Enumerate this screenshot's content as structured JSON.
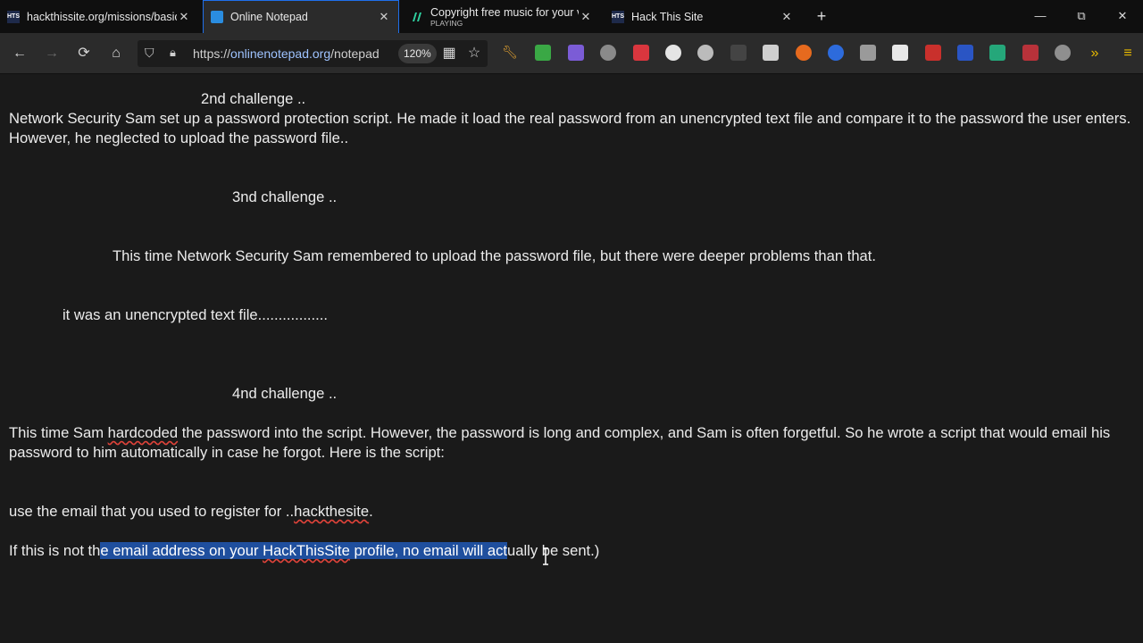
{
  "browser": {
    "tabs": [
      {
        "title": "hackthissite.org/missions/basic",
        "favicon": "HTS",
        "active": false
      },
      {
        "title": "Online Notepad",
        "favicon": "notepad-icon",
        "active": true
      },
      {
        "title": "Copyright free music for your vi",
        "subtitle": "PLAYING",
        "favicon": "music-icon",
        "active": false
      },
      {
        "title": "Hack This Site",
        "favicon": "HTS",
        "active": false
      }
    ],
    "close_glyph": "✕",
    "new_tab_glyph": "+",
    "window_controls": {
      "minimize": "—",
      "restore": "⧉",
      "close": "✕"
    }
  },
  "toolbar": {
    "url_prefix": "https://",
    "url_host": "onlinenotepad.org",
    "url_path": "/notepad",
    "zoom": "120%",
    "icons": [
      "back-icon",
      "forward-icon",
      "reload-icon",
      "home-icon",
      "shield-icon",
      "lock-icon",
      "qr-icon",
      "star-icon"
    ]
  },
  "document": {
    "challenge2_heading": "2nd challenge ..",
    "challenge2_text": "Network Security Sam set up a password protection script. He made it load the real password from an unencrypted text file and compare it to the password the user enters. However, he neglected to upload the password file..",
    "challenge3_heading": "3nd challenge ..",
    "challenge3_text": "This time Network Security Sam remembered to upload the password file, but there were deeper problems than that.",
    "challenge3_note": "it was an unencrypted text file.................",
    "challenge4_heading": "4nd challenge ..",
    "challenge4_text_a": "This time Sam ",
    "challenge4_text_misspelled": "hardcoded",
    "challenge4_text_b": " the password into the script. However, the password is long and complex, and Sam is often forgetful. So he wrote a script that would email his password to him automatically in case he forgot. Here is the script:",
    "hint_a": "use the email that you used to register for ..",
    "hint_misspelled": "hackthesite",
    "hint_b": ".",
    "note_before": "If this is not th",
    "note_selected_a": "e email address on your ",
    "note_selected_misspelled": "HackThisSite",
    "note_selected_b": " profile, no email will act",
    "note_after": "ually be sent.)"
  },
  "colors": {
    "selection": "#1f4f9e",
    "accent": "#1f6feb",
    "spellcheck": "#e0433a"
  }
}
